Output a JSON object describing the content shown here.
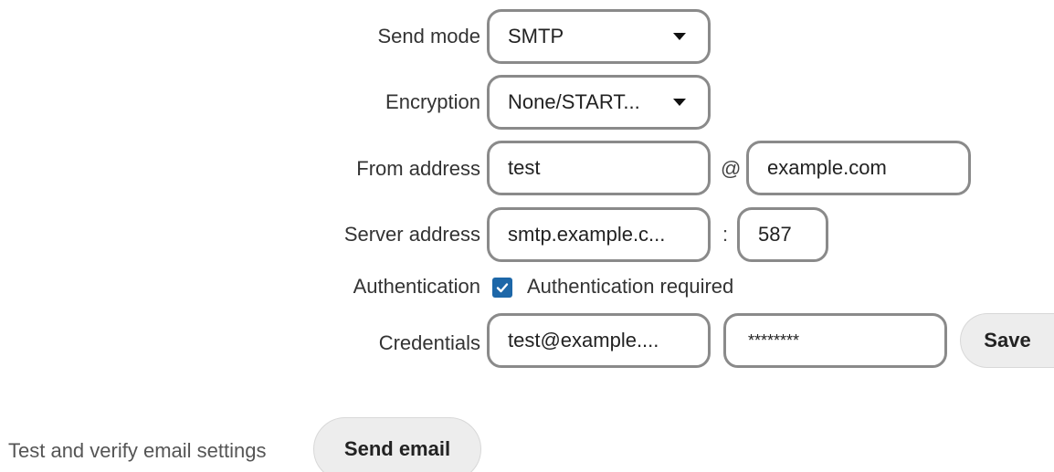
{
  "send_mode": {
    "label": "Send mode",
    "value": "SMTP"
  },
  "encryption": {
    "label": "Encryption",
    "value": "None/START..."
  },
  "from_address": {
    "label": "From address",
    "user": "test",
    "separator": "@",
    "domain": "example.com"
  },
  "server_address": {
    "label": "Server address",
    "host": "smtp.example.c...",
    "separator": ":",
    "port": "587"
  },
  "authentication": {
    "label": "Authentication",
    "checkbox_label": "Authentication required",
    "checked": true
  },
  "credentials": {
    "label": "Credentials",
    "username": "test@example....",
    "password": "********",
    "save_label": "Save"
  },
  "test": {
    "text": "Test and verify email settings",
    "button_label": "Send email"
  },
  "colors": {
    "checkbox": "#1d67a8",
    "field_border": "#8a8a8a",
    "button_bg": "#ededed"
  }
}
